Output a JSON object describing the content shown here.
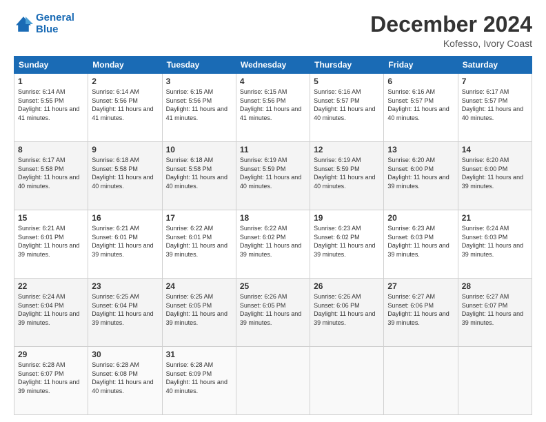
{
  "header": {
    "logo_line1": "General",
    "logo_line2": "Blue",
    "month": "December 2024",
    "location": "Kofesso, Ivory Coast"
  },
  "days_of_week": [
    "Sunday",
    "Monday",
    "Tuesday",
    "Wednesday",
    "Thursday",
    "Friday",
    "Saturday"
  ],
  "weeks": [
    [
      {
        "day": "1",
        "sunrise": "Sunrise: 6:14 AM",
        "sunset": "Sunset: 5:55 PM",
        "daylight": "Daylight: 11 hours and 41 minutes."
      },
      {
        "day": "2",
        "sunrise": "Sunrise: 6:14 AM",
        "sunset": "Sunset: 5:56 PM",
        "daylight": "Daylight: 11 hours and 41 minutes."
      },
      {
        "day": "3",
        "sunrise": "Sunrise: 6:15 AM",
        "sunset": "Sunset: 5:56 PM",
        "daylight": "Daylight: 11 hours and 41 minutes."
      },
      {
        "day": "4",
        "sunrise": "Sunrise: 6:15 AM",
        "sunset": "Sunset: 5:56 PM",
        "daylight": "Daylight: 11 hours and 41 minutes."
      },
      {
        "day": "5",
        "sunrise": "Sunrise: 6:16 AM",
        "sunset": "Sunset: 5:57 PM",
        "daylight": "Daylight: 11 hours and 40 minutes."
      },
      {
        "day": "6",
        "sunrise": "Sunrise: 6:16 AM",
        "sunset": "Sunset: 5:57 PM",
        "daylight": "Daylight: 11 hours and 40 minutes."
      },
      {
        "day": "7",
        "sunrise": "Sunrise: 6:17 AM",
        "sunset": "Sunset: 5:57 PM",
        "daylight": "Daylight: 11 hours and 40 minutes."
      }
    ],
    [
      {
        "day": "8",
        "sunrise": "Sunrise: 6:17 AM",
        "sunset": "Sunset: 5:58 PM",
        "daylight": "Daylight: 11 hours and 40 minutes."
      },
      {
        "day": "9",
        "sunrise": "Sunrise: 6:18 AM",
        "sunset": "Sunset: 5:58 PM",
        "daylight": "Daylight: 11 hours and 40 minutes."
      },
      {
        "day": "10",
        "sunrise": "Sunrise: 6:18 AM",
        "sunset": "Sunset: 5:58 PM",
        "daylight": "Daylight: 11 hours and 40 minutes."
      },
      {
        "day": "11",
        "sunrise": "Sunrise: 6:19 AM",
        "sunset": "Sunset: 5:59 PM",
        "daylight": "Daylight: 11 hours and 40 minutes."
      },
      {
        "day": "12",
        "sunrise": "Sunrise: 6:19 AM",
        "sunset": "Sunset: 5:59 PM",
        "daylight": "Daylight: 11 hours and 40 minutes."
      },
      {
        "day": "13",
        "sunrise": "Sunrise: 6:20 AM",
        "sunset": "Sunset: 6:00 PM",
        "daylight": "Daylight: 11 hours and 39 minutes."
      },
      {
        "day": "14",
        "sunrise": "Sunrise: 6:20 AM",
        "sunset": "Sunset: 6:00 PM",
        "daylight": "Daylight: 11 hours and 39 minutes."
      }
    ],
    [
      {
        "day": "15",
        "sunrise": "Sunrise: 6:21 AM",
        "sunset": "Sunset: 6:01 PM",
        "daylight": "Daylight: 11 hours and 39 minutes."
      },
      {
        "day": "16",
        "sunrise": "Sunrise: 6:21 AM",
        "sunset": "Sunset: 6:01 PM",
        "daylight": "Daylight: 11 hours and 39 minutes."
      },
      {
        "day": "17",
        "sunrise": "Sunrise: 6:22 AM",
        "sunset": "Sunset: 6:01 PM",
        "daylight": "Daylight: 11 hours and 39 minutes."
      },
      {
        "day": "18",
        "sunrise": "Sunrise: 6:22 AM",
        "sunset": "Sunset: 6:02 PM",
        "daylight": "Daylight: 11 hours and 39 minutes."
      },
      {
        "day": "19",
        "sunrise": "Sunrise: 6:23 AM",
        "sunset": "Sunset: 6:02 PM",
        "daylight": "Daylight: 11 hours and 39 minutes."
      },
      {
        "day": "20",
        "sunrise": "Sunrise: 6:23 AM",
        "sunset": "Sunset: 6:03 PM",
        "daylight": "Daylight: 11 hours and 39 minutes."
      },
      {
        "day": "21",
        "sunrise": "Sunrise: 6:24 AM",
        "sunset": "Sunset: 6:03 PM",
        "daylight": "Daylight: 11 hours and 39 minutes."
      }
    ],
    [
      {
        "day": "22",
        "sunrise": "Sunrise: 6:24 AM",
        "sunset": "Sunset: 6:04 PM",
        "daylight": "Daylight: 11 hours and 39 minutes."
      },
      {
        "day": "23",
        "sunrise": "Sunrise: 6:25 AM",
        "sunset": "Sunset: 6:04 PM",
        "daylight": "Daylight: 11 hours and 39 minutes."
      },
      {
        "day": "24",
        "sunrise": "Sunrise: 6:25 AM",
        "sunset": "Sunset: 6:05 PM",
        "daylight": "Daylight: 11 hours and 39 minutes."
      },
      {
        "day": "25",
        "sunrise": "Sunrise: 6:26 AM",
        "sunset": "Sunset: 6:05 PM",
        "daylight": "Daylight: 11 hours and 39 minutes."
      },
      {
        "day": "26",
        "sunrise": "Sunrise: 6:26 AM",
        "sunset": "Sunset: 6:06 PM",
        "daylight": "Daylight: 11 hours and 39 minutes."
      },
      {
        "day": "27",
        "sunrise": "Sunrise: 6:27 AM",
        "sunset": "Sunset: 6:06 PM",
        "daylight": "Daylight: 11 hours and 39 minutes."
      },
      {
        "day": "28",
        "sunrise": "Sunrise: 6:27 AM",
        "sunset": "Sunset: 6:07 PM",
        "daylight": "Daylight: 11 hours and 39 minutes."
      }
    ],
    [
      {
        "day": "29",
        "sunrise": "Sunrise: 6:28 AM",
        "sunset": "Sunset: 6:07 PM",
        "daylight": "Daylight: 11 hours and 39 minutes."
      },
      {
        "day": "30",
        "sunrise": "Sunrise: 6:28 AM",
        "sunset": "Sunset: 6:08 PM",
        "daylight": "Daylight: 11 hours and 40 minutes."
      },
      {
        "day": "31",
        "sunrise": "Sunrise: 6:28 AM",
        "sunset": "Sunset: 6:09 PM",
        "daylight": "Daylight: 11 hours and 40 minutes."
      },
      null,
      null,
      null,
      null
    ]
  ]
}
